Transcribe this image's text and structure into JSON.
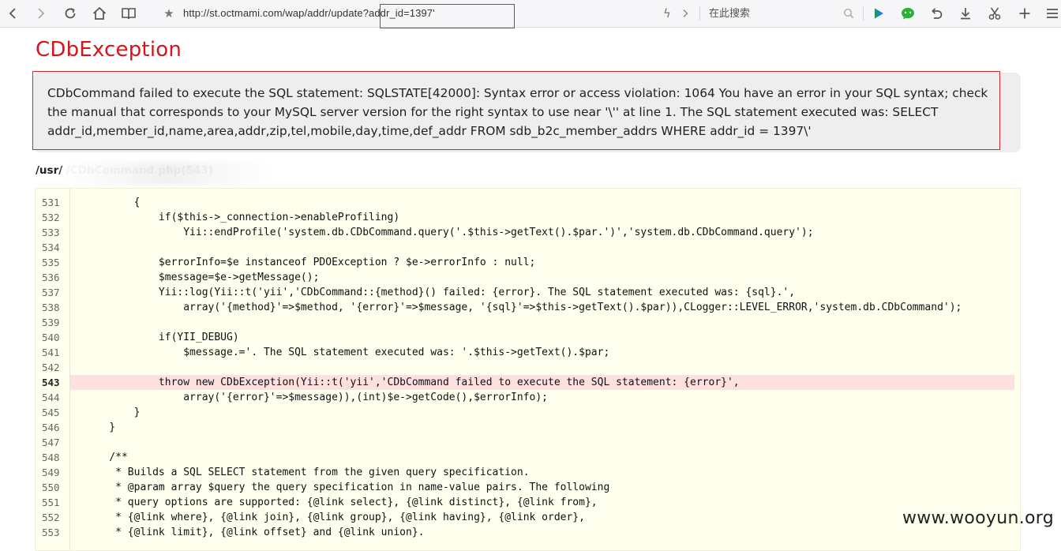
{
  "browser": {
    "url": "http://st.octmami.com/wap/addr/update?addr_id=1397'",
    "search_placeholder": "在此搜索"
  },
  "error": {
    "title": "CDbException",
    "message": "CDbCommand failed to execute the SQL statement: SQLSTATE[42000]: Syntax error or access violation: 1064 You have an error in your SQL syntax; check the manual that corresponds to your MySQL server version for the right syntax to use near '\\'' at line 1. The SQL statement executed was: SELECT addr_id,member_id,name,area,addr,zip,tel,mobile,day,time,def_addr FROM sdb_b2c_member_addrs WHERE addr_id = 1397\\'",
    "file_path": "/usr/            /CDbCommand.php(543)"
  },
  "source": {
    "error_line": "543",
    "lines": [
      {
        "no": "531",
        "code": "        {"
      },
      {
        "no": "532",
        "code": "            if($this->_connection->enableProfiling)"
      },
      {
        "no": "533",
        "code": "                Yii::endProfile('system.db.CDbCommand.query('.$this->getText().$par.')','system.db.CDbCommand.query');"
      },
      {
        "no": "534",
        "code": ""
      },
      {
        "no": "535",
        "code": "            $errorInfo=$e instanceof PDOException ? $e->errorInfo : null;"
      },
      {
        "no": "536",
        "code": "            $message=$e->getMessage();"
      },
      {
        "no": "537",
        "code": "            Yii::log(Yii::t('yii','CDbCommand::{method}() failed: {error}. The SQL statement executed was: {sql}.',"
      },
      {
        "no": "538",
        "code": "                array('{method}'=>$method, '{error}'=>$message, '{sql}'=>$this->getText().$par)),CLogger::LEVEL_ERROR,'system.db.CDbCommand');"
      },
      {
        "no": "539",
        "code": ""
      },
      {
        "no": "540",
        "code": "            if(YII_DEBUG)"
      },
      {
        "no": "541",
        "code": "                $message.='. The SQL statement executed was: '.$this->getText().$par;"
      },
      {
        "no": "542",
        "code": ""
      },
      {
        "no": "543",
        "code": "            throw new CDbException(Yii::t('yii','CDbCommand failed to execute the SQL statement: {error}',"
      },
      {
        "no": "544",
        "code": "                array('{error}'=>$message)),(int)$e->getCode(),$errorInfo);"
      },
      {
        "no": "545",
        "code": "        }"
      },
      {
        "no": "546",
        "code": "    }"
      },
      {
        "no": "547",
        "code": ""
      },
      {
        "no": "548",
        "code": "    /**"
      },
      {
        "no": "549",
        "code": "     * Builds a SQL SELECT statement from the given query specification."
      },
      {
        "no": "550",
        "code": "     * @param array $query the query specification in name-value pairs. The following"
      },
      {
        "no": "551",
        "code": "     * query options are supported: {@link select}, {@link distinct}, {@link from},"
      },
      {
        "no": "552",
        "code": "     * {@link where}, {@link join}, {@link group}, {@link having}, {@link order},"
      },
      {
        "no": "553",
        "code": "     * {@link limit}, {@link offset} and {@link union}."
      }
    ]
  },
  "watermark": "www.wooyun.org",
  "colors": {
    "title_red": "#d8141b",
    "highlight_red": "#d9262c",
    "code_bg": "#ffffee",
    "error_line_bg": "#ffe0e0"
  }
}
